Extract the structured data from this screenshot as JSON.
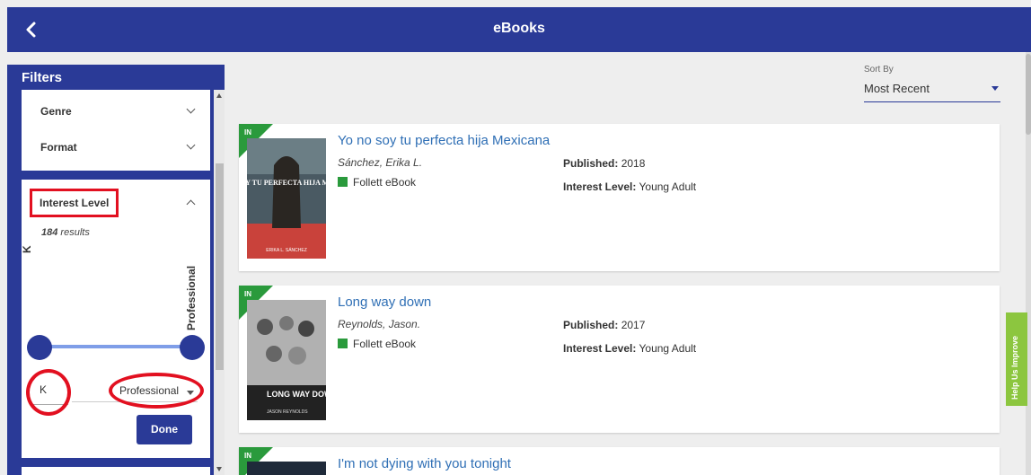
{
  "header": {
    "title": "eBooks",
    "back_icon": "chevron-left-icon"
  },
  "filters": {
    "title": "Filters",
    "collapsed": [
      {
        "label": "Genre"
      },
      {
        "label": "Format"
      }
    ],
    "interest_level": {
      "label": "Interest Level",
      "results_count": "184",
      "results_suffix": "results",
      "min_label": "K",
      "max_label": "Professional",
      "min_value": "K",
      "max_value": "Professional",
      "done_label": "Done"
    }
  },
  "sort": {
    "label": "Sort By",
    "value": "Most Recent"
  },
  "books": [
    {
      "badge": "IN",
      "title": "Yo no soy tu perfecta hija Mexicana",
      "author": "Sánchez, Erika L.",
      "format": "Follett eBook",
      "published_label": "Published:",
      "published": "2018",
      "interest_label": "Interest Level:",
      "interest": "Young Adult",
      "cover_title": "YO NO SOY TU PERFECTA HIJA MEXICANA",
      "cover_author": "ERIKA L. SÁNCHEZ"
    },
    {
      "badge": "IN",
      "title": "Long way down",
      "author": "Reynolds, Jason.",
      "format": "Follett eBook",
      "published_label": "Published:",
      "published": "2017",
      "interest_label": "Interest Level:",
      "interest": "Young Adult",
      "cover_title": "LONG WAY DOWN",
      "cover_author": "JASON REYNOLDS"
    },
    {
      "badge": "IN",
      "title": "I'm not dying with you tonight"
    }
  ],
  "help": {
    "label": "Help Us Improve"
  },
  "colors": {
    "primary": "#2a3a97",
    "link": "#2f6fb5",
    "badge": "#2a9a3c",
    "highlight": "#e21020",
    "help": "#8cc63f"
  }
}
